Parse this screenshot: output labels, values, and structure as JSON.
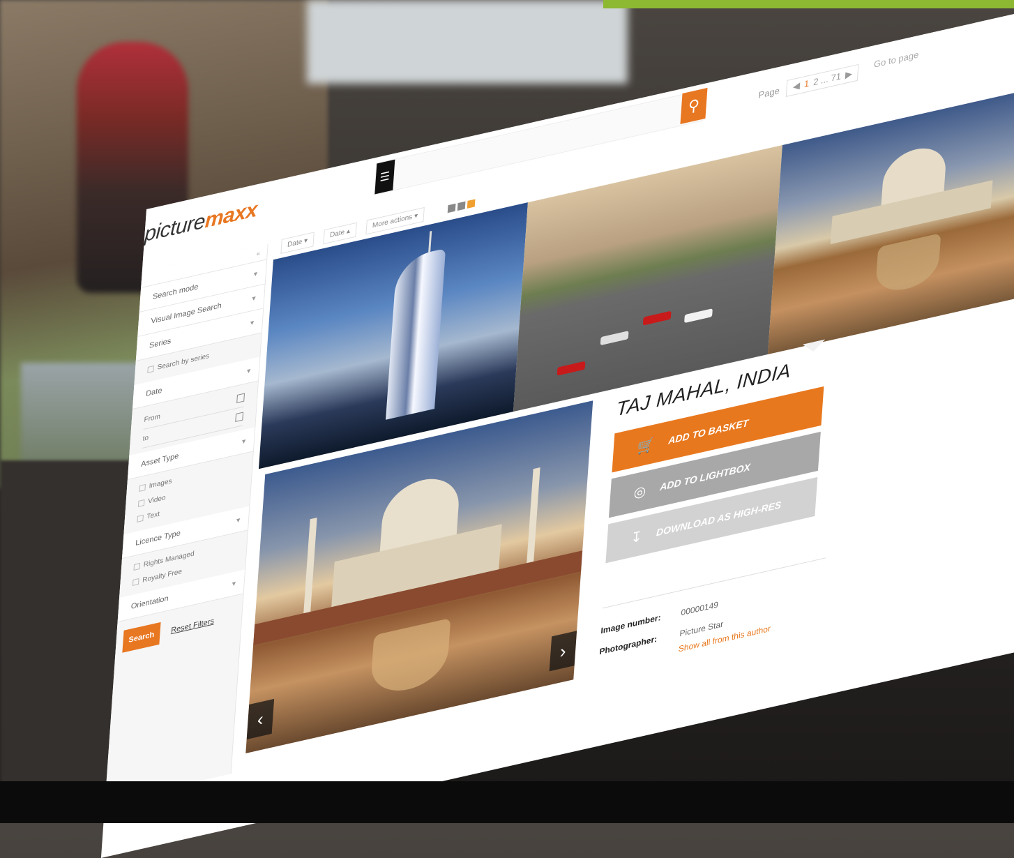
{
  "app": {
    "logo_part1": "picture",
    "logo_part2": "maxx"
  },
  "pager": {
    "label": "Page",
    "current": "1",
    "range": "2 ... 71",
    "goto_label": "Go to page"
  },
  "toolbar": {
    "sort1": "Date",
    "sort2": "Date",
    "more": "More actions"
  },
  "sidebar": {
    "rows": [
      "Search mode",
      "Visual Image Search",
      "Series"
    ],
    "series_opt": "Search by series",
    "date_header": "Date",
    "from_label": "From",
    "to_label": "to",
    "asset_type": "Asset Type",
    "asset_opts": [
      "Images",
      "Video",
      "Text"
    ],
    "licence_type": "Licence Type",
    "licence_opts": [
      "Rights Managed",
      "Royalty Free"
    ],
    "orientation": "Orientation",
    "search_btn": "Search",
    "reset_btn": "Reset Filters"
  },
  "detail": {
    "title": "TAJ MAHAL, INDIA",
    "add_basket": "ADD TO BASKET",
    "add_lightbox": "ADD TO LIGHTBOX",
    "download": "DOWNLOAD AS HIGH-RES",
    "image_number_label": "Image number:",
    "image_number": "00000149",
    "photographer_label": "Photographer:",
    "photographer": "Picture Star",
    "author_link": "Show all from this author"
  },
  "colors": {
    "accent": "#e87722",
    "brand_green": "#8cb832",
    "lightbox_btn": "#a8a8a8",
    "download_btn": "#d2d2d2"
  }
}
